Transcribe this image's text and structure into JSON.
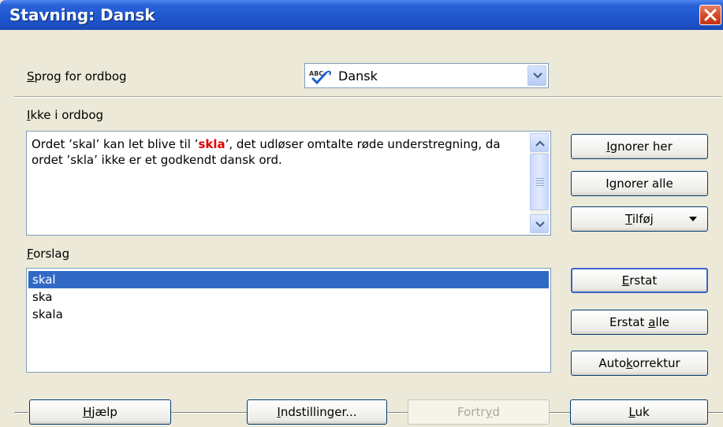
{
  "window": {
    "title": "Stavning: Dansk"
  },
  "language": {
    "label_pre": "",
    "label_accel": "S",
    "label_post": "prog for ordbog",
    "selected": "Dansk",
    "icon": "spellcheck-abc-icon"
  },
  "not_in_dictionary": {
    "label_accel": "I",
    "label_post": "kke i ordbog",
    "text_part1": "Ordet ’skal’ kan let blive til ’",
    "text_error": "skla",
    "text_part2": "’, det udløser omtalte røde understregning, da ordet ’skla’ ikke er et godkendt dansk ord."
  },
  "suggestions": {
    "label_accel": "F",
    "label_post": "orslag",
    "items": [
      "skal",
      "ska",
      "skala"
    ],
    "selected_index": 0
  },
  "buttons": {
    "ignore_once": {
      "pre": "",
      "accel": "I",
      "post": "gnorer her"
    },
    "ignore_all": {
      "pre": "I",
      "accel": "g",
      "post": "norer alle"
    },
    "add": {
      "pre": "",
      "accel": "T",
      "post": "ilføj"
    },
    "replace": {
      "pre": "",
      "accel": "E",
      "post": "rstat"
    },
    "replace_all": {
      "pre": "Erstat ",
      "accel": "a",
      "post": "lle"
    },
    "autocorrect": {
      "pre": "Auto",
      "accel": "k",
      "post": "orrektur"
    },
    "help": {
      "pre": "",
      "accel": "H",
      "post": "jælp"
    },
    "options": {
      "pre": "",
      "accel": "I",
      "post": "ndstillinger..."
    },
    "undo": {
      "pre": "Fortr",
      "accel": "y",
      "post": "d"
    },
    "close": {
      "pre": "",
      "accel": "L",
      "post": "uk"
    }
  },
  "colors": {
    "title_bar": "#2a63d8",
    "selection": "#316ac5",
    "error_word": "#e00000",
    "dialog_bg": "#ece9d8"
  }
}
